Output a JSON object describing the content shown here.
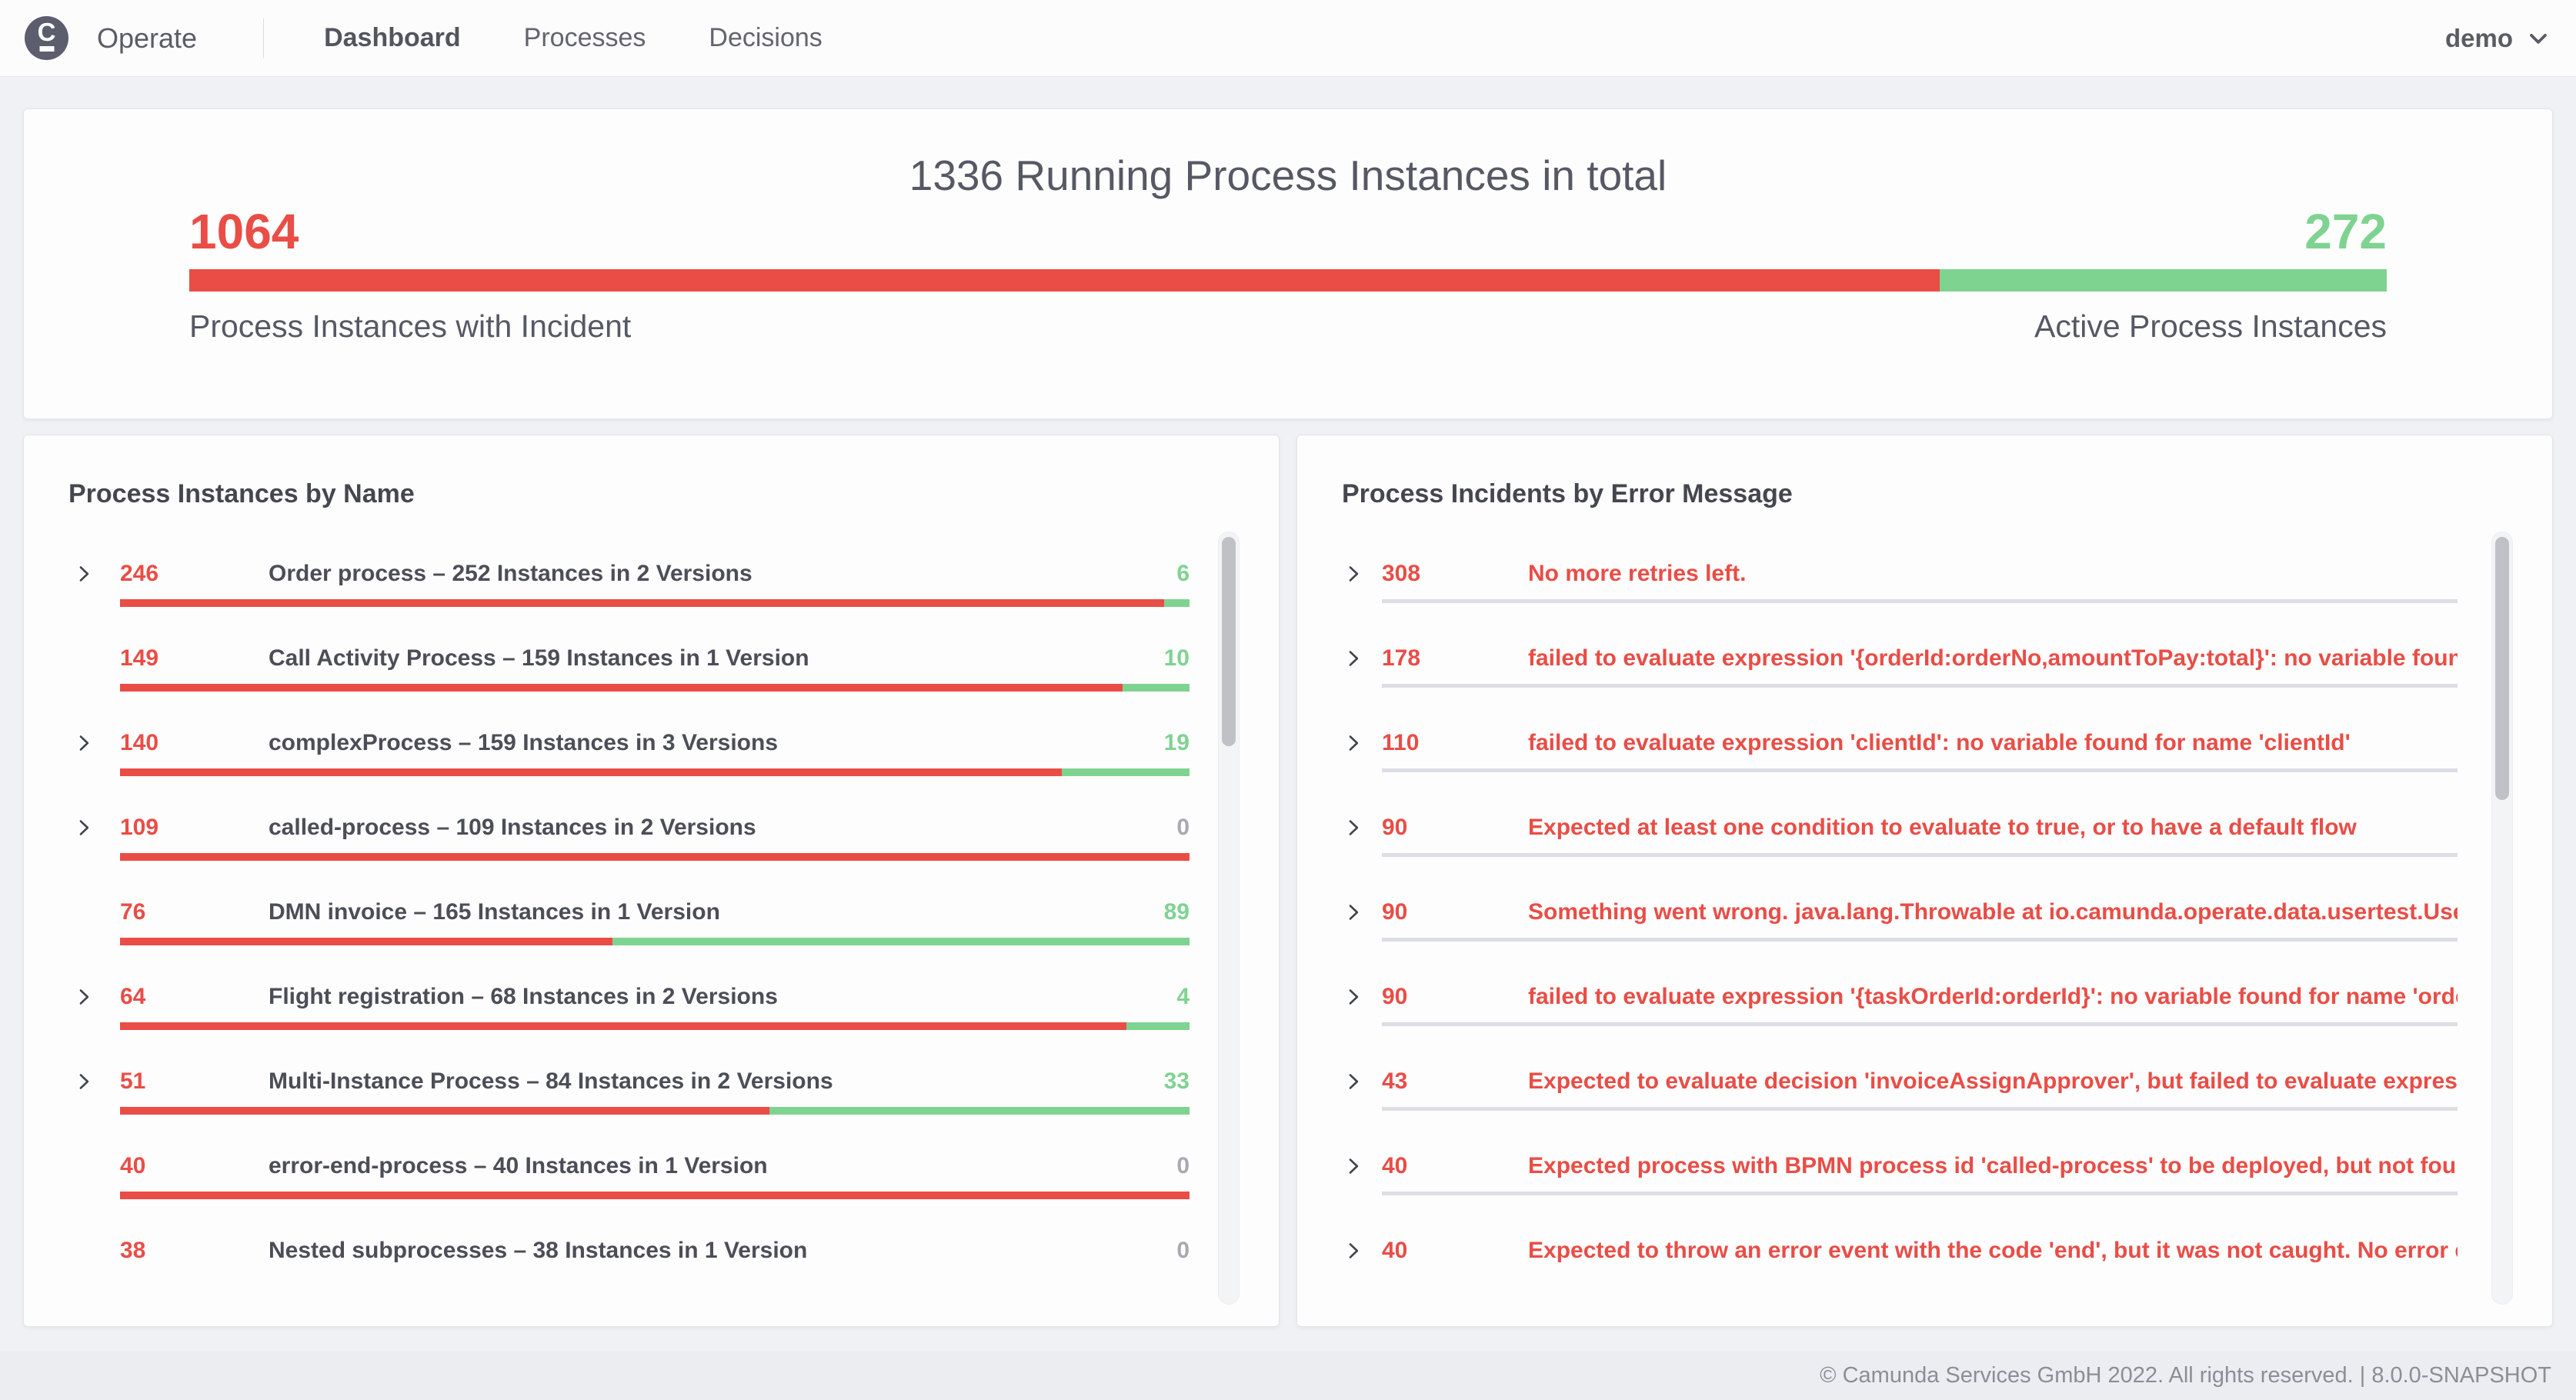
{
  "nav": {
    "brand": "Operate",
    "tabs": [
      {
        "label": "Dashboard",
        "active": true
      },
      {
        "label": "Processes",
        "active": false
      },
      {
        "label": "Decisions",
        "active": false
      }
    ],
    "user": "demo"
  },
  "metric": {
    "title": "1336 Running Process Instances in total",
    "total": 1336,
    "incidents": {
      "count": "1064",
      "label": "Process Instances with Incident"
    },
    "active": {
      "count": "272",
      "label": "Active Process Instances"
    }
  },
  "instances_panel": {
    "title": "Process Instances by Name",
    "rows": [
      {
        "incidents": 246,
        "active": 6,
        "label": "Order process – 252 Instances in 2 Versions",
        "expandable": true
      },
      {
        "incidents": 149,
        "active": 10,
        "label": "Call Activity Process – 159 Instances in 1 Version",
        "expandable": false
      },
      {
        "incidents": 140,
        "active": 19,
        "label": "complexProcess – 159 Instances in 3 Versions",
        "expandable": true
      },
      {
        "incidents": 109,
        "active": 0,
        "label": "called-process – 109 Instances in 2 Versions",
        "expandable": true
      },
      {
        "incidents": 76,
        "active": 89,
        "label": "DMN invoice – 165 Instances in 1 Version",
        "expandable": false
      },
      {
        "incidents": 64,
        "active": 4,
        "label": "Flight registration – 68 Instances in 2 Versions",
        "expandable": true
      },
      {
        "incidents": 51,
        "active": 33,
        "label": "Multi-Instance Process – 84 Instances in 2 Versions",
        "expandable": true
      },
      {
        "incidents": 40,
        "active": 0,
        "label": "error-end-process – 40 Instances in 1 Version",
        "expandable": false
      },
      {
        "incidents": 38,
        "active": 0,
        "label": "Nested subprocesses – 38 Instances in 1 Version",
        "expandable": false
      }
    ]
  },
  "incidents_panel": {
    "title": "Process Incidents by Error Message",
    "rows": [
      {
        "count": 308,
        "message": "No more retries left."
      },
      {
        "count": 178,
        "message": "failed to evaluate expression '{orderId:orderNo,amountToPay:total}': no variable found for ..."
      },
      {
        "count": 110,
        "message": "failed to evaluate expression 'clientId': no variable found for name 'clientId'"
      },
      {
        "count": 90,
        "message": "Expected at least one condition to evaluate to true, or to have a default flow"
      },
      {
        "count": 90,
        "message": "Something went wrong. java.lang.Throwable at io.camunda.operate.data.usertest.UserTes..."
      },
      {
        "count": 90,
        "message": "failed to evaluate expression '{taskOrderId:orderId}': no variable found for name 'orderId'"
      },
      {
        "count": 43,
        "message": "Expected to evaluate decision 'invoiceAssignApprover', but failed to evaluate expression 'a..."
      },
      {
        "count": 40,
        "message": "Expected process with BPMN process id 'called-process' to be deployed, but not found."
      },
      {
        "count": 40,
        "message": "Expected to throw an error event with the code 'end', but it was not caught. No error event..."
      }
    ]
  },
  "footer": {
    "text": "© Camunda Services GmbH 2022. All rights reserved. | 8.0.0-SNAPSHOT"
  },
  "colors": {
    "incident": "#E94D46",
    "active": "#7FD391",
    "zero_count": "#A8AAB0",
    "divider": "#DCDEE4"
  }
}
